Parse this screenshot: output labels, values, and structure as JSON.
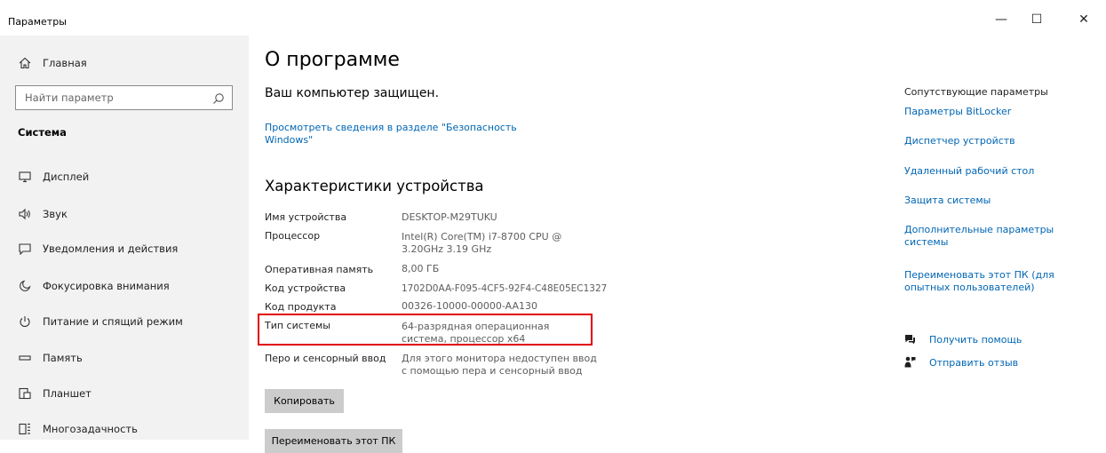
{
  "window": {
    "title": "Параметры",
    "minimize_glyph": "—",
    "maximize_glyph": "☐",
    "close_glyph": "✕"
  },
  "sidebar": {
    "home_label": "Главная",
    "search_placeholder": "Найти параметр",
    "section_title": "Система",
    "items": [
      {
        "label": "Дисплей",
        "icon": "display-icon"
      },
      {
        "label": "Звук",
        "icon": "sound-icon"
      },
      {
        "label": "Уведомления и действия",
        "icon": "notifications-icon"
      },
      {
        "label": "Фокусировка внимания",
        "icon": "focus-assist-icon"
      },
      {
        "label": "Питание и спящий режим",
        "icon": "power-icon"
      },
      {
        "label": "Память",
        "icon": "storage-icon"
      },
      {
        "label": "Планшет",
        "icon": "tablet-icon"
      },
      {
        "label": "Многозадачность",
        "icon": "multitasking-icon"
      }
    ]
  },
  "main": {
    "title": "О программе",
    "protection_status": "Ваш компьютер защищен.",
    "security_link": "Просмотреть сведения в разделе \"Безопасность Windows\"",
    "specs_title": "Характеристики устройства",
    "specs": [
      {
        "label": "Имя устройства",
        "value": "DESKTOP-M29TUKU"
      },
      {
        "label": "Процессор",
        "value": "Intel(R) Core(TM) i7-8700 CPU @ 3.20GHz 3.19 GHz"
      },
      {
        "label": "Оперативная память",
        "value": "8,00 ГБ"
      },
      {
        "label": "Код устройства",
        "value": "1702D0AA-F095-4CF5-92F4-C48E05EC1327"
      },
      {
        "label": "Код продукта",
        "value": "00326-10000-00000-AA130"
      },
      {
        "label": "Тип системы",
        "value": "64-разрядная операционная система, процессор x64"
      },
      {
        "label": "Перо и сенсорный ввод",
        "value": "Для этого монитора недоступен ввод с помощью пера и сенсорный ввод"
      }
    ],
    "copy_button": "Копировать",
    "rename_button": "Переименовать этот ПК"
  },
  "related": {
    "title": "Сопутствующие параметры",
    "links": [
      "Параметры BitLocker",
      "Диспетчер устройств",
      "Удаленный рабочий стол",
      "Защита системы",
      "Дополнительные параметры системы",
      "Переименовать этот ПК (для опытных пользователей)"
    ],
    "help_link": "Получить помощь",
    "feedback_link": "Отправить отзыв"
  },
  "colors": {
    "link": "#0066b4",
    "sidebar_bg": "#f2f2f2",
    "highlight": "#e00000",
    "button_bg": "#cccccc"
  }
}
